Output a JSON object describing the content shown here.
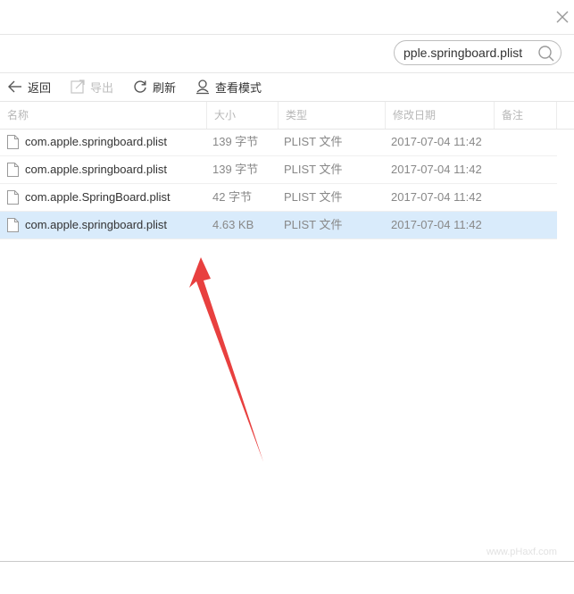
{
  "search": {
    "value": "pple.springboard.plist"
  },
  "toolbar": {
    "back_label": "返回",
    "export_label": "导出",
    "refresh_label": "刷新",
    "view_mode_label": "查看模式"
  },
  "table": {
    "headers": {
      "name": "名称",
      "size": "大小",
      "type": "类型",
      "modified": "修改日期",
      "notes": "备注"
    },
    "rows": [
      {
        "name": "com.apple.springboard.plist",
        "size": "139 字节",
        "type": "PLIST 文件",
        "modified": "2017-07-04 11:42",
        "selected": false
      },
      {
        "name": "com.apple.springboard.plist",
        "size": "139 字节",
        "type": "PLIST 文件",
        "modified": "2017-07-04 11:42",
        "selected": false
      },
      {
        "name": "com.apple.SpringBoard.plist",
        "size": "42 字节",
        "type": "PLIST 文件",
        "modified": "2017-07-04 11:42",
        "selected": false
      },
      {
        "name": "com.apple.springboard.plist",
        "size": "4.63 KB",
        "type": "PLIST 文件",
        "modified": "2017-07-04 11:42",
        "selected": true
      }
    ]
  },
  "annotation": {
    "arrow_color": "#e8403f"
  },
  "watermark": {
    "text": "www.pHaxf.com"
  },
  "icons": [
    "close-icon",
    "search-icon",
    "back-arrow-icon",
    "export-icon",
    "refresh-icon",
    "view-mode-icon",
    "file-icon"
  ]
}
